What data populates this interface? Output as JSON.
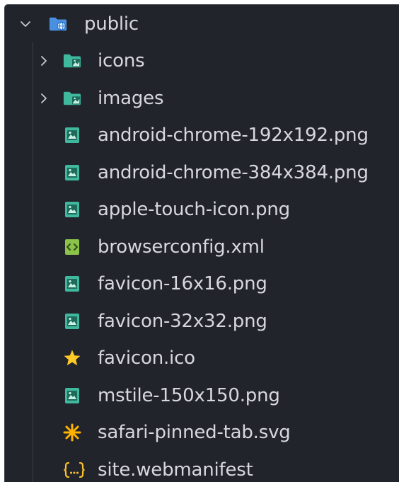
{
  "tree": {
    "root": {
      "label": "public",
      "icon": "folder-web-icon",
      "expanded": true
    },
    "items": [
      {
        "label": "icons",
        "kind": "folder",
        "icon": "folder-image-icon",
        "expanded": false
      },
      {
        "label": "images",
        "kind": "folder",
        "icon": "folder-image-icon",
        "expanded": false
      },
      {
        "label": "android-chrome-192x192.png",
        "kind": "file",
        "icon": "image-file-icon"
      },
      {
        "label": "android-chrome-384x384.png",
        "kind": "file",
        "icon": "image-file-icon"
      },
      {
        "label": "apple-touch-icon.png",
        "kind": "file",
        "icon": "image-file-icon"
      },
      {
        "label": "browserconfig.xml",
        "kind": "file",
        "icon": "xml-file-icon"
      },
      {
        "label": "favicon-16x16.png",
        "kind": "file",
        "icon": "image-file-icon"
      },
      {
        "label": "favicon-32x32.png",
        "kind": "file",
        "icon": "image-file-icon"
      },
      {
        "label": "favicon.ico",
        "kind": "file",
        "icon": "star-icon"
      },
      {
        "label": "mstile-150x150.png",
        "kind": "file",
        "icon": "image-file-icon"
      },
      {
        "label": "safari-pinned-tab.svg",
        "kind": "file",
        "icon": "svg-asterisk-icon"
      },
      {
        "label": "site.webmanifest",
        "kind": "file",
        "icon": "json-braces-icon"
      }
    ]
  },
  "colors": {
    "background": "#22242b",
    "text": "#d6d8dd",
    "image_icon": "#3fb89e",
    "folder_icon": "#3fb89e",
    "folder_web_icon": "#4a90e2",
    "xml_icon": "#8bc34a",
    "star_icon": "#ffca28",
    "svg_icon": "#ffb300",
    "json_icon": "#fbc02d",
    "chevron": "#c8cbd1"
  }
}
